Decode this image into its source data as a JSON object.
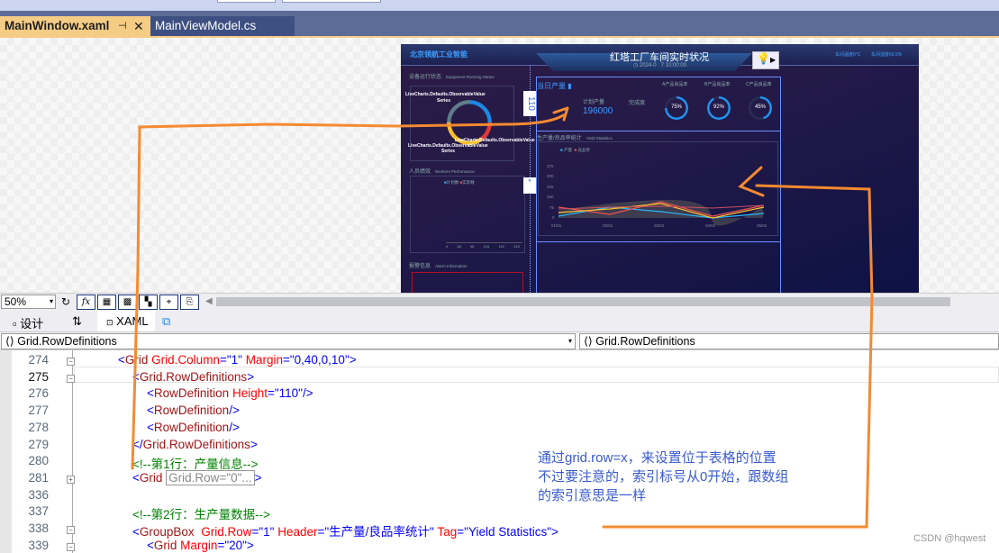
{
  "editor_tabs": [
    {
      "label": "MainWindow.xaml",
      "active": true,
      "pin_icon": "pin-icon",
      "close_icon": "close-icon"
    },
    {
      "label": "MainViewModel.cs",
      "active": false
    }
  ],
  "dashboard": {
    "brand": "北京领航工业智能",
    "title": "红塔工厂车间实时状况",
    "datetime_left": "2024-0",
    "datetime_right": "7 10:00:00",
    "temperature": "车间温度0°C",
    "humidity": "车间湿度60.5%",
    "equipment": {
      "title": "设备运行状态",
      "subtitle": "Equipment Running Status",
      "series_label": "LiveCharts.Defaults.ObservableValue",
      "series_suffix": "Series"
    },
    "workers": {
      "title": "人员绩效",
      "subtitle": "Workers Performance",
      "legend": [
        "计划数",
        "实际数"
      ],
      "ticks": [
        "0",
        "48",
        "96",
        "144",
        "192",
        "240"
      ]
    },
    "alarm": {
      "title": "报警信息",
      "subtitle": "Alarm Information"
    },
    "production": {
      "title": "当日产量",
      "plan_label": "计划产量",
      "plan_value": "196000",
      "complete_label": "完成度",
      "rates": [
        {
          "label": "A产品良品率",
          "value": "75%",
          "pct": 75
        },
        {
          "label": "B产品良品率",
          "value": "92%",
          "pct": 92
        },
        {
          "label": "C产品良品率",
          "value": "45%",
          "pct": 45
        }
      ]
    },
    "yield": {
      "title": "生产量/良品率统计",
      "subtitle": "Yield Statistics",
      "legend": [
        "产量",
        "良品率"
      ],
      "yticks": [
        "375",
        "300",
        "225",
        "150",
        "75",
        "0"
      ],
      "xticks": [
        "01/01",
        "02/01",
        "03/02",
        "04/02",
        "05/02"
      ]
    },
    "row_height_adorner": "110",
    "star_adorner": "*",
    "lightbulb_icon": "lightbulb-icon"
  },
  "toolbar": {
    "zoom": "50%",
    "buttons": [
      "refresh-icon",
      "fx-icon",
      "grid-icon",
      "snap-icon",
      "artboard-icon",
      "snap-lines-icon",
      "effects-icon"
    ]
  },
  "view_tabs": {
    "design": "设计",
    "swap": "⇅",
    "xaml": "XAML",
    "popout": "popout-icon"
  },
  "breadcrumbs": {
    "left": "Grid.RowDefinitions",
    "right": "Grid.RowDefinitions"
  },
  "code_lines": [
    {
      "n": "274",
      "text": "<Grid Grid.Column=\"1\" Margin=\"0,40,0,10\">"
    },
    {
      "n": "275",
      "text": "<Grid.RowDefinitions>"
    },
    {
      "n": "276",
      "text": "<RowDefinition Height=\"110\"/>"
    },
    {
      "n": "277",
      "text": "<RowDefinition/>"
    },
    {
      "n": "278",
      "text": "<RowDefinition/>"
    },
    {
      "n": "279",
      "text": "</Grid.RowDefinitions>"
    },
    {
      "n": "280",
      "text": "<!--第1行：产量信息-->"
    },
    {
      "n": "281",
      "text": "<Grid",
      "collapsed": "Grid.Row=\"0\"...",
      "end": ">"
    },
    {
      "n": "336",
      "text": ""
    },
    {
      "n": "337",
      "text": "<!--第2行：生产量数据-->"
    },
    {
      "n": "338",
      "text": "<GroupBox  Grid.Row=\"1\" Header=\"生产量/良品率统计\" Tag=\"Yield Statistics\">"
    },
    {
      "n": "339",
      "text": "<Grid Margin=\"20\">"
    }
  ],
  "annotation": {
    "lines": [
      "通过grid.row=x，来设置位于表格的位置",
      "不过要注意的，索引标号从0开始，跟数组",
      "的索引意思是一样"
    ],
    "color": "#f58a30"
  },
  "watermark": "CSDN @hqwest"
}
